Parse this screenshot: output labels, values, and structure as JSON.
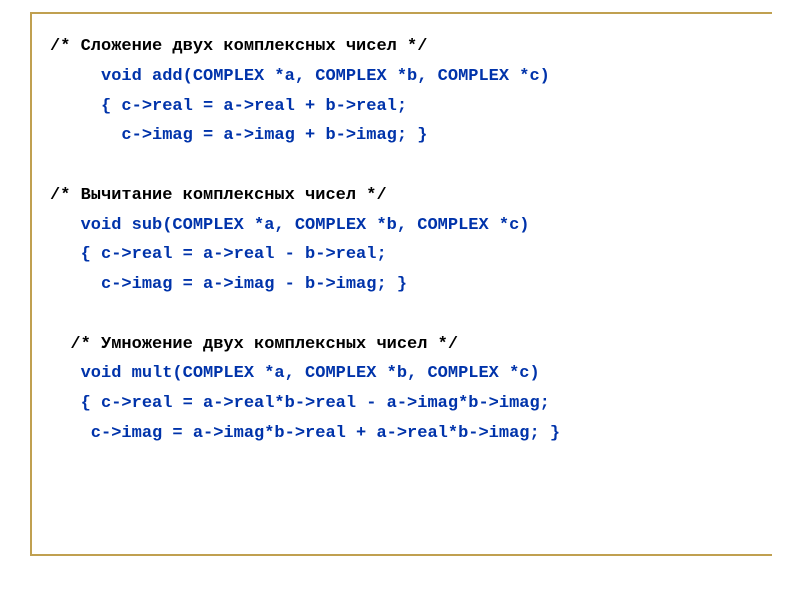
{
  "lines": {
    "c1": "/* Сложение двух комплексных чисел */",
    "a1": "     void add(COMPLEX *a, COMPLEX *b, COMPLEX *c)",
    "a2": "     { c->real = a->real + b->real;",
    "a3": "       c->imag = a->imag + b->imag; }",
    "blank1": " ",
    "c2": "/* Вычитание комплексных чисел */",
    "s1": "   void sub(COMPLEX *a, COMPLEX *b, COMPLEX *c)",
    "s2": "   { c->real = a->real - b->real;",
    "s3": "     c->imag = a->imag - b->imag; }",
    "blank2": " ",
    "c3": "  /* Умножение двух комплексных чисел */",
    "m1": "   void mult(COMPLEX *a, COMPLEX *b, COMPLEX *c)",
    "m2": "   { c->real = a->real*b->real - a->imag*b->imag;",
    "m3": "    c->imag = a->imag*b->real + a->real*b->imag; }"
  }
}
